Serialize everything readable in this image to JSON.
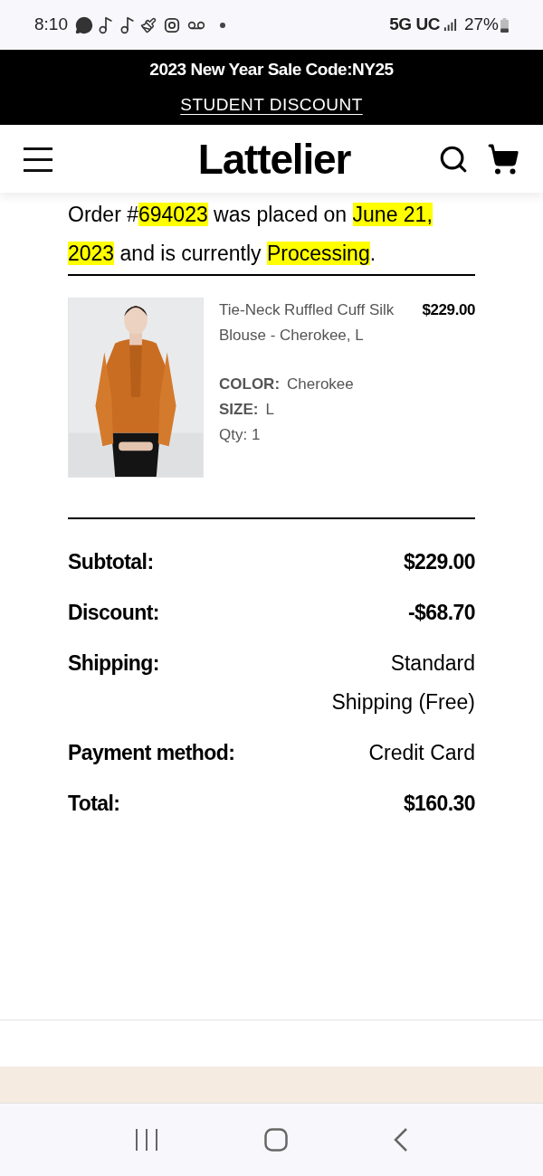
{
  "status_bar": {
    "time": "8:10",
    "network": "5G UC",
    "battery": "27%"
  },
  "promo_banner": {
    "text": "2023 New Year Sale Code:NY25",
    "link": "STUDENT DISCOUNT"
  },
  "header": {
    "logo": "Lattelier"
  },
  "order_status": [
    {
      "text": "Order #",
      "highlighted": false
    },
    {
      "text": "694023",
      "highlighted": true
    },
    {
      "text": " was placed on ",
      "highlighted": false
    },
    {
      "text": "June 21, 2023",
      "highlighted": true
    },
    {
      "text": " and is currently ",
      "highlighted": false
    },
    {
      "text": "Processing",
      "highlighted": true
    },
    {
      "text": ".",
      "highlighted": false
    }
  ],
  "items": [
    {
      "name": "Tie-Neck Ruffled Cuff Silk Blouse - Cherokee, L",
      "price": "$229.00",
      "attributes": [
        {
          "label": "COLOR:",
          "value": "Cherokee"
        },
        {
          "label": "SIZE:",
          "value": "L"
        }
      ],
      "qty": "Qty: 1"
    }
  ],
  "summary": [
    {
      "label": "Subtotal:",
      "value": "$229.00",
      "bold": true
    },
    {
      "label": "Discount:",
      "value": "-$68.70",
      "bold": true
    },
    {
      "label": "Shipping:",
      "value": "Standard Shipping (Free)",
      "bold": false
    },
    {
      "label": "Payment method:",
      "value": "Credit Card",
      "bold": false
    },
    {
      "label": "Total:",
      "value": "$160.30",
      "bold": true
    }
  ]
}
